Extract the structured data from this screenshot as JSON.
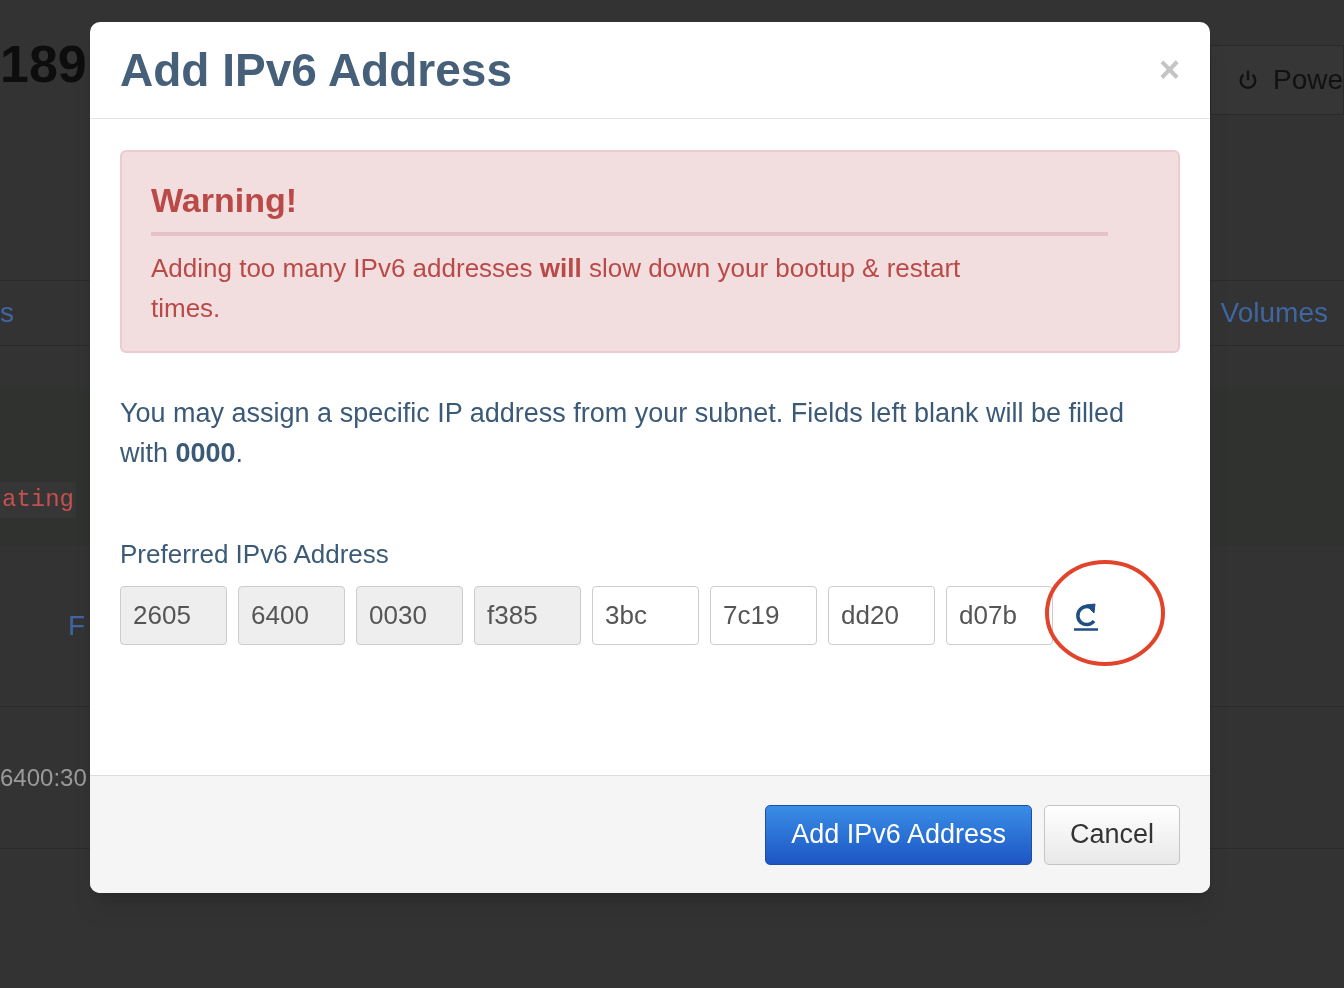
{
  "background": {
    "heading": "189",
    "power_button": "Powe",
    "tabs": [
      {
        "label": "s"
      },
      {
        "label": "Volumes"
      }
    ],
    "code_text": "ating",
    "link_text": "F",
    "address_text": "6400:30"
  },
  "modal": {
    "title": "Add IPv6 Address",
    "close": "×",
    "warning": {
      "title": "Warning!",
      "text": "Adding too many IPv6 addresses **will** slow down your bootup & restart times."
    },
    "intro": "You may assign a specific IP address from your subnet. Fields left blank will be filled with **0000**.",
    "field_label": "Preferred IPv6 Address",
    "segments": [
      {
        "value": "2605",
        "disabled": true
      },
      {
        "value": "6400",
        "disabled": true
      },
      {
        "value": "0030",
        "disabled": true
      },
      {
        "value": "f385",
        "disabled": true
      },
      {
        "value": "3bc",
        "disabled": false
      },
      {
        "value": "7c19",
        "disabled": false
      },
      {
        "value": "dd20",
        "disabled": false
      },
      {
        "value": "d07b",
        "disabled": false
      }
    ],
    "buttons": [
      {
        "label": "Add IPv6 Address",
        "kind": "primary"
      },
      {
        "label": "Cancel",
        "kind": "default"
      }
    ]
  }
}
